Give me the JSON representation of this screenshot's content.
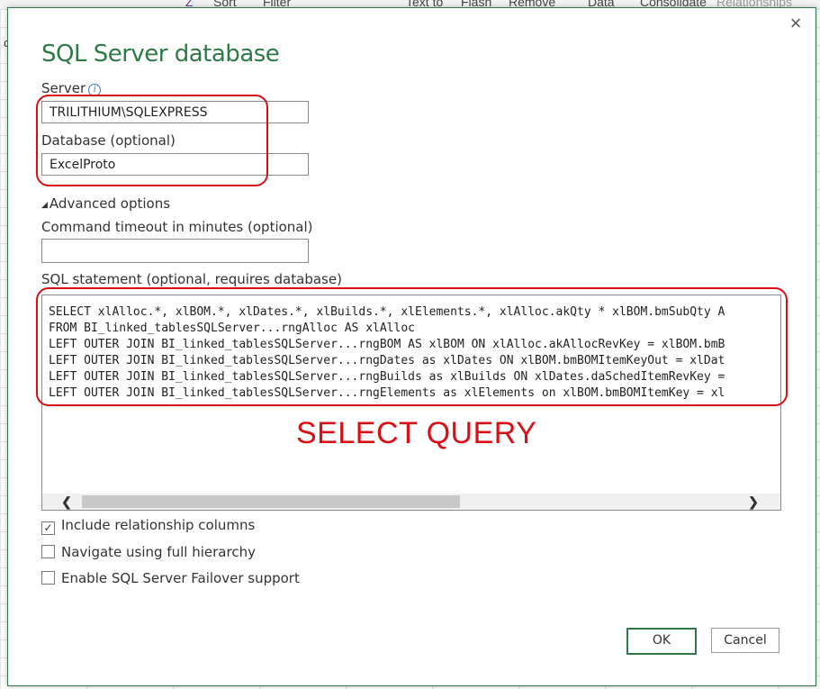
{
  "background": {
    "ribbon_items": [
      "Z",
      "Sort",
      "Filter",
      "Text to",
      "Flash",
      "Remove",
      "Data",
      "Consolidate",
      "Relationships"
    ],
    "edge_letter": "c"
  },
  "dialog": {
    "title": "SQL Server database",
    "close_icon": "×",
    "server_label": "Server",
    "server_value": "TRILITHIUM\\SQLEXPRESS",
    "database_label": "Database (optional)",
    "database_value": "ExcelProto",
    "advanced_label": "Advanced options",
    "timeout_label": "Command timeout in minutes (optional)",
    "timeout_value": "",
    "sql_label": "SQL statement (optional, requires database)",
    "sql_lines": [
      "SELECT xlAlloc.*, xlBOM.*, xlDates.*, xlBuilds.*, xlElements.*, xlAlloc.akQty * xlBOM.bmSubQty A",
      "FROM BI_linked_tablesSQLServer...rngAlloc AS xlAlloc",
      "LEFT OUTER JOIN BI_linked_tablesSQLServer...rngBOM AS xlBOM ON xlAlloc.akAllocRevKey = xlBOM.bmB",
      "LEFT OUTER JOIN BI_linked_tablesSQLServer...rngDates as xlDates ON xlBOM.bmBOMItemKeyOut = xlDat",
      "LEFT OUTER JOIN BI_linked_tablesSQLServer...rngBuilds as xlBuilds ON xlDates.daSchedItemRevKey =",
      "LEFT OUTER JOIN BI_linked_tablesSQLServer...rngElements as xlElements on xlBOM.bmBOMItemKey = xl"
    ],
    "annotation_text": "SELECT QUERY",
    "annotation_color": "#d90f16",
    "accent_color": "#2e7a46",
    "checkboxes": [
      {
        "label": "Include relationship columns",
        "checked": true
      },
      {
        "label": "Navigate using full hierarchy",
        "checked": false
      },
      {
        "label": "Enable SQL Server Failover support",
        "checked": false
      }
    ],
    "ok_label": "OK",
    "cancel_label": "Cancel"
  }
}
